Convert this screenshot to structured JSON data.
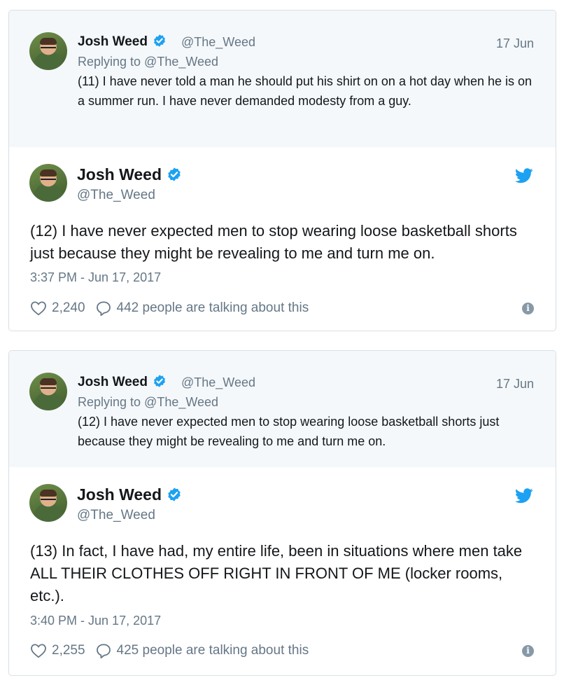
{
  "brand": {
    "verified_color": "#1da1f2",
    "twitter_color": "#1da1f2"
  },
  "cards": [
    {
      "parent": {
        "name": "Josh Weed",
        "handle": "@The_Weed",
        "date": "17 Jun",
        "replying_to": "Replying to @The_Weed",
        "text": "(11) I have never told a man he should put his shirt on on a hot day when he is on a summer run. I have never demanded modesty from a guy."
      },
      "tweet": {
        "name": "Josh Weed",
        "handle": "@The_Weed",
        "text": "(12) I have never expected men to stop wearing loose basketball shorts just because they might be revealing to me and turn me on.",
        "timestamp": "3:37 PM - Jun 17, 2017",
        "likes": "2,240",
        "talking": "442 people are talking about this"
      }
    },
    {
      "parent": {
        "name": "Josh Weed",
        "handle": "@The_Weed",
        "date": "17 Jun",
        "replying_to": "Replying to @The_Weed",
        "text": "(12) I have never expected men to stop wearing loose basketball shorts just because they might be revealing to me and turn me on."
      },
      "tweet": {
        "name": "Josh Weed",
        "handle": "@The_Weed",
        "text": "(13) In fact, I have had, my entire life, been in situations where men take ALL THEIR CLOTHES OFF RIGHT IN FRONT OF ME (locker rooms, etc.).",
        "timestamp": "3:40 PM - Jun 17, 2017",
        "likes": "2,255",
        "talking": "425 people are talking about this"
      }
    }
  ],
  "icons": {
    "verified": "verified-badge-icon",
    "bird": "twitter-bird-icon",
    "heart": "heart-icon",
    "comment": "comment-bubble-icon",
    "info": "info-icon"
  }
}
